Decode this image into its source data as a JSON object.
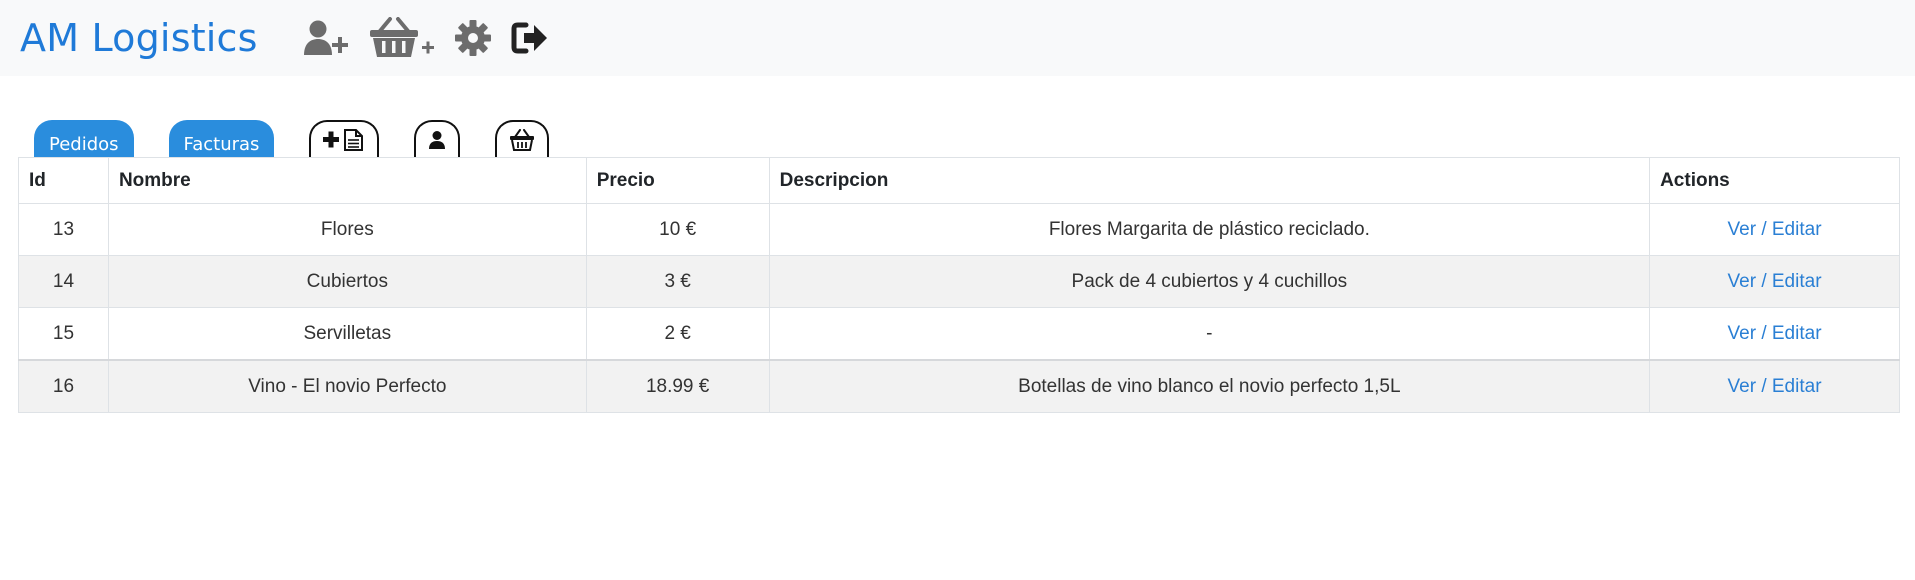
{
  "app": {
    "title": "AM Logistics"
  },
  "nav": {
    "icons": [
      "add-user-icon",
      "add-basket-icon",
      "settings-gear-icon",
      "logout-icon"
    ]
  },
  "tabs": {
    "pedidos": "Pedidos",
    "facturas": "Facturas",
    "icon_tabs": [
      "add-document-icon",
      "user-icon",
      "basket-icon"
    ]
  },
  "table": {
    "columns": {
      "id": "Id",
      "nombre": "Nombre",
      "precio": "Precio",
      "descripcion": "Descripcion",
      "actions": "Actions"
    },
    "rows": [
      {
        "id": "13",
        "nombre": "Flores",
        "precio": "10 €",
        "descripcion": "Flores Margarita de plástico reciclado.",
        "action": "Ver / Editar"
      },
      {
        "id": "14",
        "nombre": "Cubiertos",
        "precio": "3 €",
        "descripcion": "Pack de 4 cubiertos y 4 cuchillos",
        "action": "Ver / Editar"
      },
      {
        "id": "15",
        "nombre": "Servilletas",
        "precio": "2 €",
        "descripcion": "-",
        "action": "Ver / Editar"
      },
      {
        "id": "16",
        "nombre": "Vino - El novio Perfecto",
        "precio": "18.99 €",
        "descripcion": "Botellas de vino blanco el novio perfecto 1,5L",
        "action": "Ver / Editar"
      }
    ]
  },
  "colors": {
    "brand": "#1f7ad8",
    "tab": "#2a8ddd",
    "link": "#2a7fd4"
  }
}
